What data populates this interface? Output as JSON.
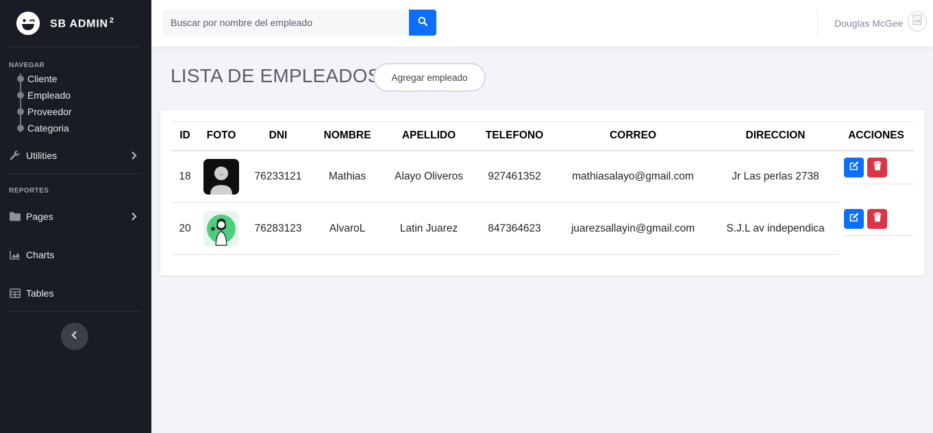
{
  "brand": {
    "name": "SB ADMIN",
    "sup": "2"
  },
  "sidebar": {
    "heading_nav": "NAVEGAR",
    "nav_items": [
      {
        "label": "Cliente"
      },
      {
        "label": "Empleado"
      },
      {
        "label": "Proveedor"
      },
      {
        "label": "Categoria"
      }
    ],
    "utilities": {
      "label": "Utilities",
      "icon": "wrench-icon"
    },
    "heading_reports": "REPORTES",
    "pages": {
      "label": "Pages",
      "icon": "folder-icon"
    },
    "charts": {
      "label": "Charts",
      "icon": "chart-area-icon"
    },
    "tables": {
      "label": "Tables",
      "icon": "table-icon"
    }
  },
  "topbar": {
    "search_placeholder": "Buscar por nombre del empleado",
    "user_name": "Douglas McGee"
  },
  "main": {
    "title": "LISTA DE EMPLEADOS",
    "add_button": "Agregar empleado"
  },
  "table": {
    "headers": [
      "ID",
      "FOTO",
      "DNI",
      "NOMBRE",
      "APELLIDO",
      "TELEFONO",
      "CORREO",
      "DIRECCION",
      "ACCIONES"
    ],
    "rows": [
      {
        "id": "18",
        "dni": "76233121",
        "nombre": "Mathias",
        "apellido": "Alayo Oliveros",
        "telefono": "927461352",
        "correo": "mathiasalayo@gmail.com",
        "direccion": "Jr Las perlas 2738"
      },
      {
        "id": "20",
        "dni": "76283123",
        "nombre": "AlvaroL",
        "apellido": "Latin Juarez",
        "telefono": "847364623",
        "correo": "juarezsallayin@gmail.com",
        "direccion": "S.J.L av independica"
      }
    ]
  },
  "colors": {
    "sidebar_bg": "#191c24",
    "primary": "#0d6efd",
    "danger": "#dc3545",
    "page_bg": "#f3f4f8"
  }
}
